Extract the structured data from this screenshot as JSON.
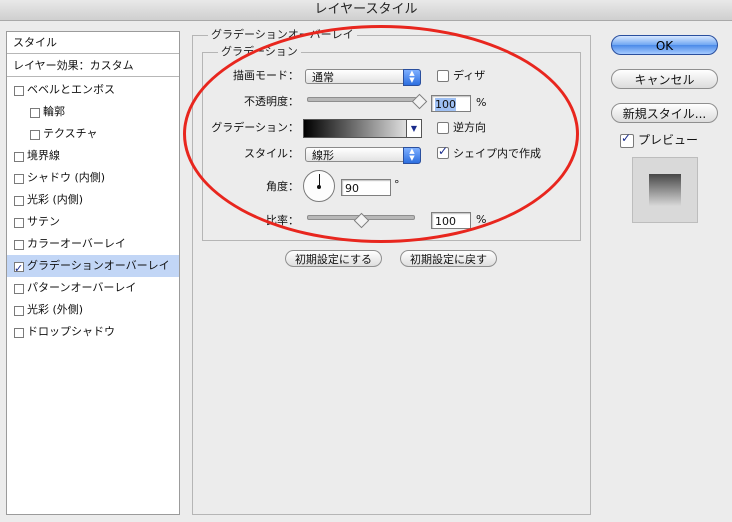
{
  "window": {
    "title": "レイヤースタイル"
  },
  "stylelist": {
    "header": "スタイル",
    "blending": "レイヤー効果：カスタム",
    "items": [
      {
        "label": "ベベルとエンボス",
        "checked": false,
        "selected": false
      },
      {
        "label": "輪郭",
        "checked": false,
        "selected": false
      },
      {
        "label": "テクスチャ",
        "checked": false,
        "selected": false
      },
      {
        "label": "境界線",
        "checked": false,
        "selected": false
      },
      {
        "label": "シャドウ (内側)",
        "checked": false,
        "selected": false
      },
      {
        "label": "光彩 (内側)",
        "checked": false,
        "selected": false
      },
      {
        "label": "サテン",
        "checked": false,
        "selected": false
      },
      {
        "label": "カラーオーバーレイ",
        "checked": false,
        "selected": false
      },
      {
        "label": "グラデーションオーバーレイ",
        "checked": true,
        "selected": true
      },
      {
        "label": "パターンオーバーレイ",
        "checked": false,
        "selected": false
      },
      {
        "label": "光彩 (外側)",
        "checked": false,
        "selected": false
      },
      {
        "label": "ドロップシャドウ",
        "checked": false,
        "selected": false
      }
    ]
  },
  "panel": {
    "outer_legend": "グラデーションオーバーレイ",
    "inner_legend": "グラデーション",
    "blend_mode": {
      "label": "描画モード：",
      "value": "通常"
    },
    "dither": {
      "label": "ディザ",
      "checked": false
    },
    "opacity": {
      "label": "不透明度：",
      "value": "100",
      "unit": "%",
      "fraction": 1.0
    },
    "gradient": {
      "label": "グラデーション："
    },
    "reverse": {
      "label": "逆方向",
      "checked": false
    },
    "style": {
      "label": "スタイル：",
      "value": "線形"
    },
    "align_with_layer": {
      "label": "シェイプ内で作成",
      "checked": true
    },
    "angle": {
      "label": "角度：",
      "value": "90",
      "unit": "°"
    },
    "scale": {
      "label": "比率：",
      "value": "100",
      "unit": "%",
      "fraction": 0.5
    },
    "reset_default": "初期設定にする",
    "restore_default": "初期設定に戻す"
  },
  "buttons": {
    "ok": "OK",
    "cancel": "キャンセル",
    "new_style": "新規スタイル...",
    "preview": {
      "label": "プレビュー",
      "checked": true
    }
  },
  "annotation": {
    "color": "#e8261e"
  },
  "colors": {
    "selection": "#c2d6f6",
    "accent": "#4b8ae8"
  }
}
